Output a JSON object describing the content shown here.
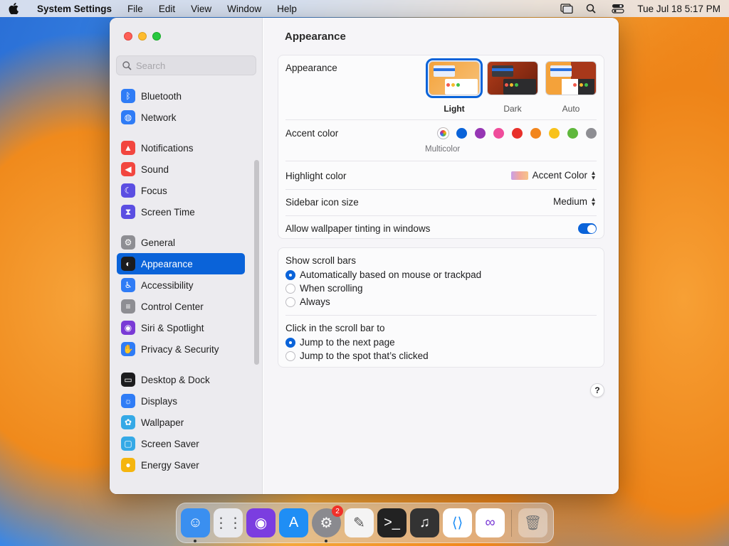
{
  "menubar": {
    "app_name": "System Settings",
    "items": [
      "File",
      "Edit",
      "View",
      "Window",
      "Help"
    ],
    "clock": "Tue Jul 18  5:17 PM"
  },
  "window": {
    "search_placeholder": "Search",
    "title": "Appearance"
  },
  "sidebar": {
    "groups": [
      [
        {
          "label": "Bluetooth",
          "icon": "bluetooth-icon",
          "color": "#2f7cf6"
        },
        {
          "label": "Network",
          "icon": "globe-icon",
          "color": "#2f7cf6"
        }
      ],
      [
        {
          "label": "Notifications",
          "icon": "bell-icon",
          "color": "#f2463f"
        },
        {
          "label": "Sound",
          "icon": "speaker-icon",
          "color": "#f2463f"
        },
        {
          "label": "Focus",
          "icon": "moon-icon",
          "color": "#5b4ee2"
        },
        {
          "label": "Screen Time",
          "icon": "hourglass-icon",
          "color": "#5b4ee2"
        }
      ],
      [
        {
          "label": "General",
          "icon": "gear-icon",
          "color": "#8e8e93"
        },
        {
          "label": "Appearance",
          "icon": "appearance-icon",
          "color": "#1c1c1e",
          "active": true
        },
        {
          "label": "Accessibility",
          "icon": "accessibility-icon",
          "color": "#2f7cf6"
        },
        {
          "label": "Control Center",
          "icon": "switches-icon",
          "color": "#8e8e93"
        },
        {
          "label": "Siri & Spotlight",
          "icon": "siri-icon",
          "color": "#7a3ad6"
        },
        {
          "label": "Privacy & Security",
          "icon": "hand-icon",
          "color": "#2f7cf6"
        }
      ],
      [
        {
          "label": "Desktop & Dock",
          "icon": "dock-icon",
          "color": "#1c1c1e"
        },
        {
          "label": "Displays",
          "icon": "sun-icon",
          "color": "#2f7cf6"
        },
        {
          "label": "Wallpaper",
          "icon": "flower-icon",
          "color": "#35a9e6"
        },
        {
          "label": "Screen Saver",
          "icon": "screensaver-icon",
          "color": "#35a9e6"
        },
        {
          "label": "Energy Saver",
          "icon": "bulb-icon",
          "color": "#f5b50e"
        }
      ]
    ]
  },
  "appearance": {
    "label": "Appearance",
    "options": [
      {
        "label": "Light",
        "selected": true
      },
      {
        "label": "Dark",
        "selected": false
      },
      {
        "label": "Auto",
        "selected": false
      }
    ]
  },
  "accent": {
    "label": "Accent color",
    "selected_caption": "Multicolor",
    "colors": [
      "multicolor",
      "#0a63d9",
      "#9636b4",
      "#ef4c9b",
      "#e8302a",
      "#f2861d",
      "#f8c21b",
      "#5fb73c",
      "#8e8e93"
    ]
  },
  "highlight": {
    "label": "Highlight color",
    "value": "Accent Color"
  },
  "sidebar_icon_size": {
    "label": "Sidebar icon size",
    "value": "Medium"
  },
  "wallpaper_tinting": {
    "label": "Allow wallpaper tinting in windows",
    "on": true
  },
  "scroll_bars": {
    "label": "Show scroll bars",
    "options": [
      {
        "label": "Automatically based on mouse or trackpad",
        "selected": true
      },
      {
        "label": "When scrolling",
        "selected": false
      },
      {
        "label": "Always",
        "selected": false
      }
    ]
  },
  "click_scroll": {
    "label": "Click in the scroll bar to",
    "options": [
      {
        "label": "Jump to the next page",
        "selected": true
      },
      {
        "label": "Jump to the spot that’s clicked",
        "selected": false
      }
    ]
  },
  "help_label": "?",
  "dock": {
    "apps": [
      {
        "name": "finder-icon",
        "color": "#3a8ff0",
        "running": true
      },
      {
        "name": "launchpad-icon",
        "color": "#e9eaee"
      },
      {
        "name": "firefox-icon",
        "color": "#7b3de0"
      },
      {
        "name": "app-store-icon",
        "color": "#1f8ef5"
      },
      {
        "name": "system-settings-icon",
        "color": "#8a8a8f",
        "badge": "2",
        "running": true
      },
      {
        "name": "textedit-icon",
        "color": "#f4f4f4"
      },
      {
        "name": "terminal-icon",
        "color": "#222"
      },
      {
        "name": "garageband-icon",
        "color": "#333"
      },
      {
        "name": "vscode-icon",
        "color": "#ffffff"
      },
      {
        "name": "visual-studio-icon",
        "color": "#ffffff"
      }
    ],
    "trash": {
      "name": "trash-icon"
    }
  }
}
